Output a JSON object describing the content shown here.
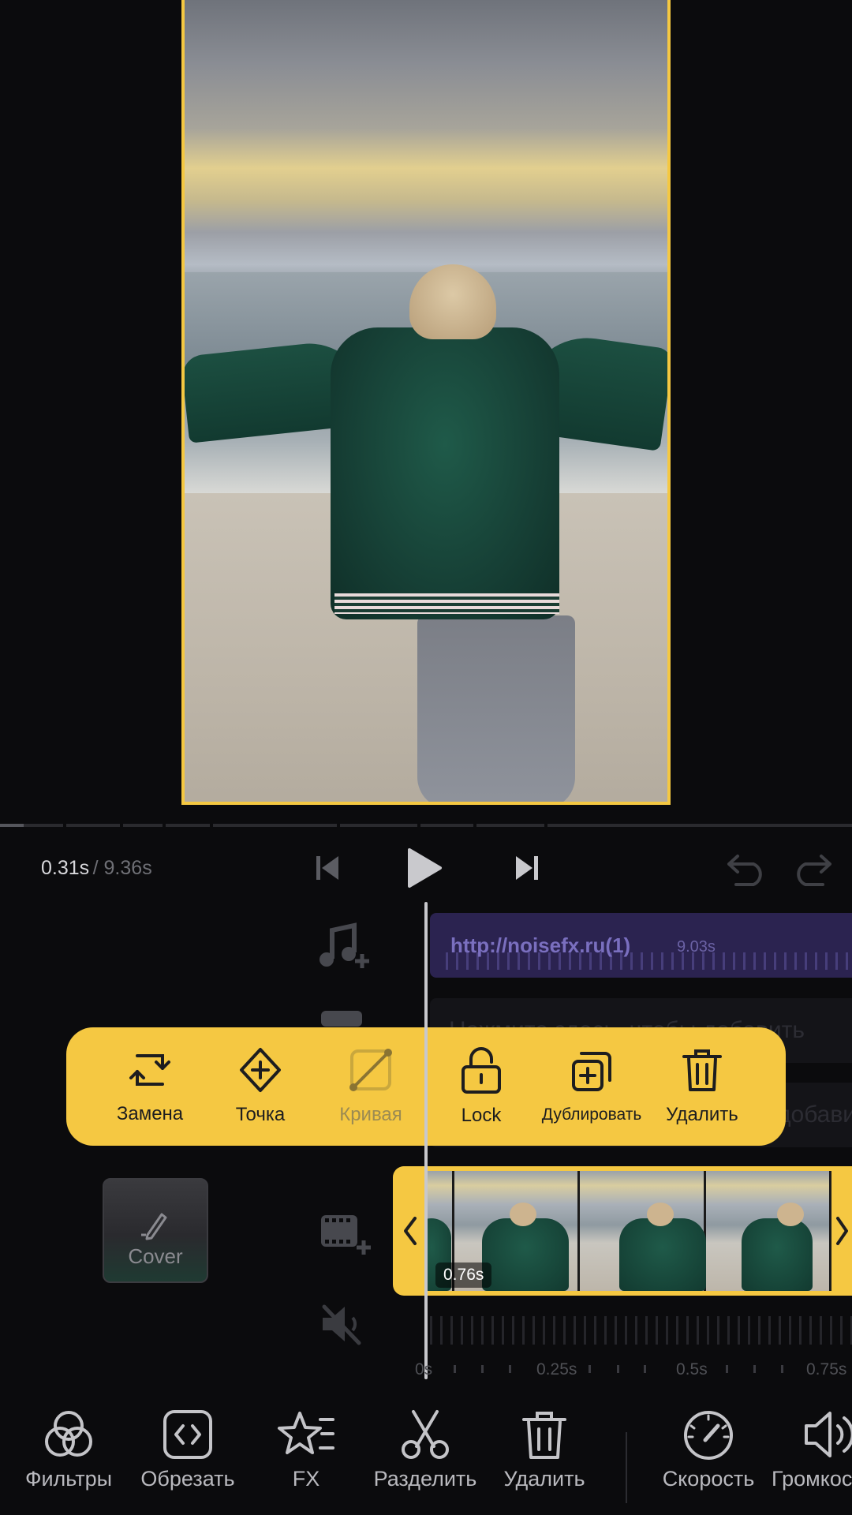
{
  "player": {
    "time_current": "0.31s",
    "time_separator": "/",
    "time_total": "9.36s",
    "playback_progress": 0.033
  },
  "timeline": {
    "audio_clip": {
      "label": "http://noisefx.ru(1)",
      "duration": "9.03s"
    },
    "text_track_hint": "Нажмите здесь, чтобы добавить",
    "text_track_hint_2": "добави",
    "cover_label": "Cover",
    "video_clip_badge": "0.76s",
    "ruler": [
      "0s",
      "0.25s",
      "0.5s",
      "0.75s"
    ]
  },
  "popup_toolbar": {
    "items": [
      {
        "label": "Замена",
        "icon": "replace-icon",
        "enabled": true
      },
      {
        "label": "Точка",
        "icon": "keyframe-icon",
        "enabled": true
      },
      {
        "label": "Кривая",
        "icon": "curve-icon",
        "enabled": false
      },
      {
        "label": "Lock",
        "icon": "unlock-icon",
        "enabled": true
      },
      {
        "label": "Дублировать",
        "icon": "duplicate-icon",
        "enabled": true
      },
      {
        "label": "Удалить",
        "icon": "trash-icon",
        "enabled": true
      }
    ]
  },
  "bottom_toolbar": {
    "items": [
      {
        "label": "Фильтры",
        "icon": "filters-icon"
      },
      {
        "label": "Обрезать",
        "icon": "trim-icon"
      },
      {
        "label": "FX",
        "icon": "fx-icon"
      },
      {
        "label": "Разделить",
        "icon": "scissors-icon"
      },
      {
        "label": "Удалить",
        "icon": "trash-icon"
      },
      {
        "label": "Скорость",
        "icon": "speed-icon"
      },
      {
        "label": "Громкость",
        "icon": "volume-icon"
      }
    ]
  },
  "colors": {
    "accent": "#f5c842",
    "background": "#0b0b0d",
    "audio_track": "#2b2350"
  }
}
